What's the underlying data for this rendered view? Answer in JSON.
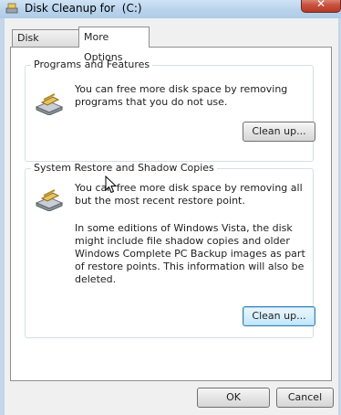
{
  "window": {
    "title": "Disk Cleanup for  (C:)",
    "close_label": "✕"
  },
  "tabs": [
    {
      "label": "Disk Cleanup",
      "selected": false
    },
    {
      "label": "More Options",
      "selected": true
    }
  ],
  "groups": {
    "programs": {
      "title": "Programs and Features",
      "description": "You can free more disk space by removing programs that you do not use.",
      "button_label": "Clean up..."
    },
    "restore": {
      "title": "System Restore and Shadow Copies",
      "description": "You can free more disk space by removing all but the most recent restore point.",
      "note": "In some editions of Windows Vista, the disk might include file shadow copies and older Windows Complete PC Backup images as part of restore points. This information will also be deleted.",
      "button_label": "Clean up..."
    }
  },
  "footer": {
    "ok_label": "OK",
    "cancel_label": "Cancel"
  }
}
